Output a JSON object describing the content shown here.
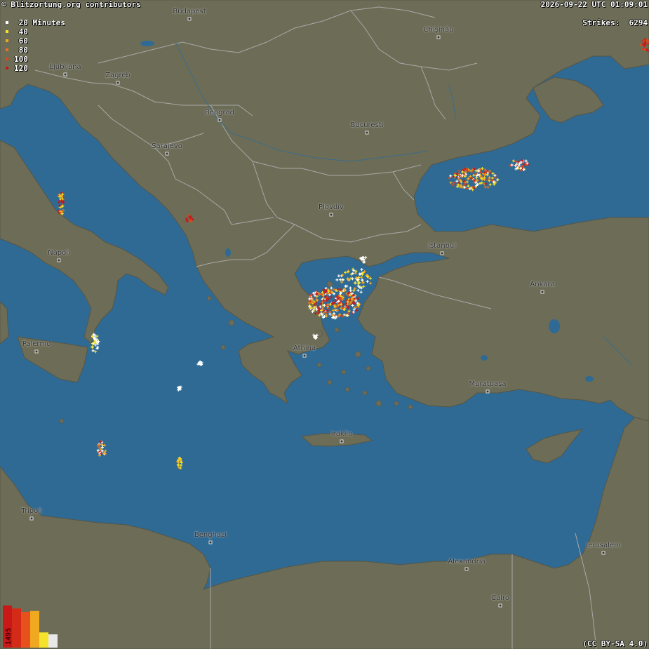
{
  "header": {
    "credit": "© Blitzortung.org contributors",
    "timestamp": "2026-09-22 UTC 01:09:01",
    "strikes_label": "Strikes:",
    "strikes_count": "6294"
  },
  "legend": {
    "items": [
      {
        "label": "20",
        "unit": "Minutes",
        "color": "#ffffff"
      },
      {
        "label": "40",
        "unit": "",
        "color": "#f5e22a"
      },
      {
        "label": "60",
        "unit": "",
        "color": "#f0a820"
      },
      {
        "label": "80",
        "unit": "",
        "color": "#e8741c"
      },
      {
        "label": "100",
        "unit": "",
        "color": "#e0461a"
      },
      {
        "label": "120",
        "unit": "",
        "color": "#c81818"
      }
    ]
  },
  "histogram": {
    "max_label": "1495",
    "bars": [
      {
        "color": "#c81818",
        "value": 1495
      },
      {
        "color": "#d42a18",
        "value": 1390
      },
      {
        "color": "#e8501c",
        "value": 1270
      },
      {
        "color": "#f0a820",
        "value": 1300
      },
      {
        "color": "#f5e22a",
        "value": 540
      },
      {
        "color": "#e8e8e8",
        "value": 470
      }
    ]
  },
  "cities": [
    "Budapest",
    "Chişinău",
    "Ljubljana",
    "Zagreb",
    "Beograd",
    "Sarajevo",
    "Bucuresti",
    "Plovdiv",
    "Istanbul",
    "Ankara",
    "Napoli",
    "Palermo",
    "Athina",
    "Muratpaşa",
    "Iraklio",
    "Tripoli",
    "Benghazi",
    "Jerusalem",
    "Alexandria",
    "Cairo"
  ],
  "license": "(CC BY-SA 4.0)",
  "colors": {
    "sea": "#2f6a94",
    "land": "#6e6e58",
    "border": "#a9a9a9"
  }
}
